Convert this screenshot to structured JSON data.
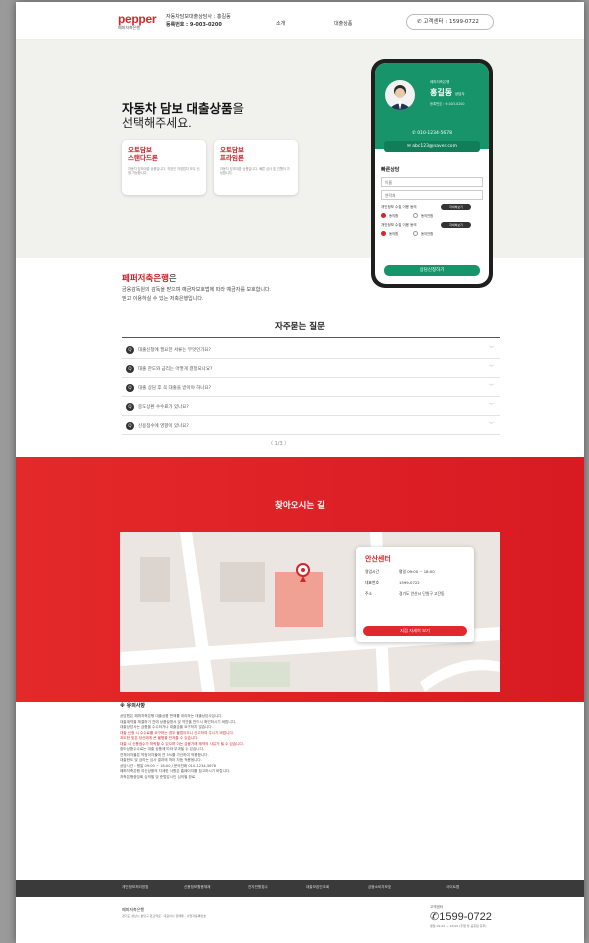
{
  "header": {
    "logo": "pepper",
    "logo_sub": "페퍼저축은행",
    "info_line1": "자동차담보대출상담사 : 홍길동",
    "info_line2": "등록번호 : 9-003-0200",
    "nav": [
      "소개",
      "대출상품"
    ],
    "phone_label": "고객센터 : 1599-0722"
  },
  "hero": {
    "title_bold": "자동차 담보 대출상품",
    "title_suffix": "을",
    "subtitle": "선택해주세요.",
    "products": [
      {
        "name": "오토담보\n스탠다드론",
        "desc": "자동차 담보대출 상품입니다. 직장인 자영업자 모두 신청 가능합니다."
      },
      {
        "name": "오토담보\n프라임론",
        "desc": "자동차 담보대출 상품입니다. 빠른 심사 및 진행이 가능합니다."
      }
    ]
  },
  "agent": {
    "company": "페퍼저축은행",
    "name": "홍길동",
    "title": "상담사",
    "reg": "등록번호 : 9-003-0200",
    "phone": "010-1234-5678",
    "email": "abc123@naver.com",
    "form_title": "빠른상담",
    "name_field": "이름",
    "phone_field": "연락처",
    "consent1": "개인정보 수집 이용 동의",
    "consent2": "개인정보 수집 이용 동의",
    "view_btn": "자세히보기",
    "agree": "동의함",
    "disagree": "동의안함",
    "submit": "상담신청하기"
  },
  "promo": {
    "title": "페퍼저축은행",
    "title_suffix": "은",
    "line1": "금융감독원의 감독을 받으며 예금자보호법에 따라 예금자를 보호합니다.",
    "line2": "믿고 이용하실 수 있는 저축은행입니다."
  },
  "faq": {
    "title": "자주묻는 질문",
    "items": [
      "대출신청에 필요한 서류는 무엇인가요?",
      "대출 한도와 금리는 어떻게 결정되나요?",
      "대출 상담 후 꼭 대출을 받아야 하나요?",
      "중도상환 수수료가 있나요?",
      "신용점수에 영향이 있나요?"
    ],
    "page": "1/3"
  },
  "location": {
    "title": "찾아오시는 길",
    "center": "안산센터",
    "rows": [
      {
        "k": "영업시간",
        "v": "평일 09:00 ~ 18:00"
      },
      {
        "k": "대표번호",
        "v": "1599-0722"
      },
      {
        "k": "주소",
        "v": "경기도 안산시 단원구 고잔동"
      }
    ],
    "btn": "지점 자세히 보기"
  },
  "caution": {
    "title": "※ 유의사항",
    "lines": [
      {
        "t": "상담원은 페퍼저축은행 대출상품 판매를 대리하는 대출상담사입니다.",
        "red": false
      },
      {
        "t": "대출계약을 체결하기 전에 상품설명서 및 약관을 반드시 확인하시기 바랍니다.",
        "red": false
      },
      {
        "t": "대출상담사는 금품을 수수하거나 대출금을 요구하지 않습니다.",
        "red": false
      },
      {
        "t": "대출 신청 시 수수료를 요구하는 경우 불법이오니 신고하여 주시기 바랍니다.",
        "red": true
      },
      {
        "t": "과도한 빚은 당신에게 큰 불행을 안겨줄 수 있습니다.",
        "red": true
      },
      {
        "t": "대출 시 신용점수가 하락할 수 있으며 이는 금융거래 제약의 사유가 될 수 있습니다.",
        "red": true
      },
      {
        "t": "중도상환수수료는 대출 상품에 따라 부과될 수 있습니다.",
        "red": false
      },
      {
        "t": "연체이자율은 약정이자율에 연 3%를 가산하여 적용합니다.",
        "red": false
      },
      {
        "t": "대출한도 및 금리는 심사 결과에 따라 차등 적용됩니다.",
        "red": false
      },
      {
        "t": "상담시간 : 평일 09:00 ~ 18:00 / 문의전화 010-1234-5678",
        "red": false
      },
      {
        "t": "페퍼저축은행 여신상품의 자세한 사항은 홈페이지를 참고하시기 바랍니다.",
        "red": false
      },
      {
        "t": "저축은행중앙회 심의필 및 준법감시인 심의필 완료",
        "red": false
      }
    ]
  },
  "footer": {
    "nav": [
      "개인정보처리방침",
      "신용정보활용체제",
      "전자민원접수",
      "대출모집인조회",
      "금융소비자보호",
      "사이트맵"
    ],
    "company": "페퍼저축은행",
    "address": "경기도 성남시 분당구 판교역로 · 대표이사 장매튜 · 사업자등록번호",
    "cc_label": "고객센터",
    "cc_number": "1599-0722",
    "hours": "평일 09:00 ~ 18:00 (주말 및 공휴일 휴무)"
  }
}
